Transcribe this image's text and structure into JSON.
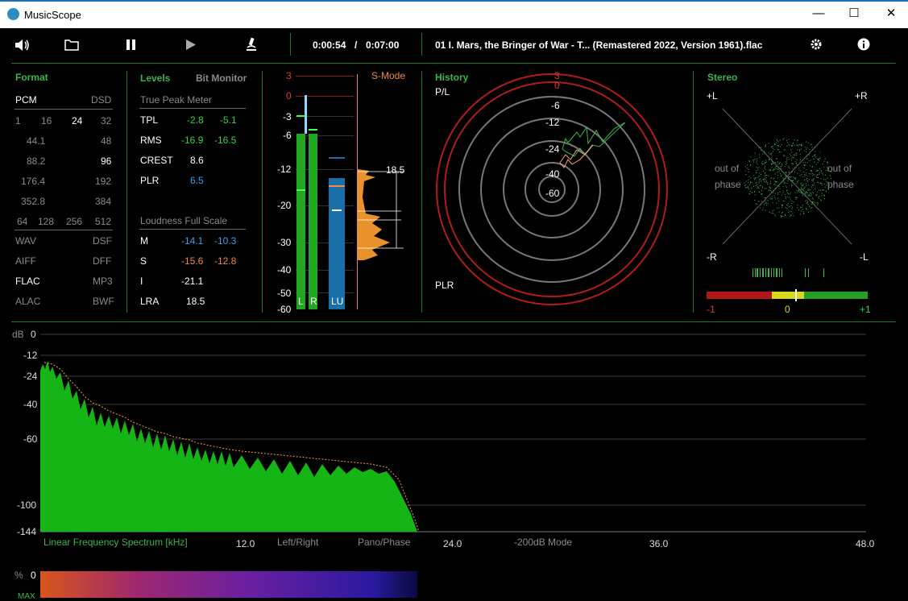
{
  "window": {
    "title": "MusicScope",
    "min": "—",
    "max": "☐",
    "close": "✕"
  },
  "toolbar": {
    "time_elapsed": "0:00:54",
    "time_sep": "/",
    "time_total": "0:07:00",
    "track": "01 I. Mars, the Bringer of War - T... (Remastered 2022, Version 1961).flac"
  },
  "format": {
    "title": "Format",
    "pcm": "PCM",
    "dsd": "DSD",
    "bits": [
      "1",
      "16",
      "24",
      "32"
    ],
    "rates": [
      [
        "44.1",
        "48"
      ],
      [
        "88.2",
        "96"
      ],
      [
        "176.4",
        "192"
      ],
      [
        "352.8",
        "384"
      ]
    ],
    "dsdrates": [
      "64",
      "128",
      "256",
      "512"
    ],
    "types": [
      [
        "WAV",
        "DSF"
      ],
      [
        "AIFF",
        "DFF"
      ],
      [
        "FLAC",
        "MP3"
      ],
      [
        "ALAC",
        "BWF"
      ]
    ]
  },
  "levels": {
    "title": "Levels",
    "bitmon": "Bit Monitor",
    "tpm_title": "True Peak Meter",
    "tpl": [
      "TPL",
      "-2.8",
      "-5.1"
    ],
    "rms": [
      "RMS",
      "-16.9",
      "-16.5"
    ],
    "crest": [
      "CREST",
      "8.6"
    ],
    "plr": [
      "PLR",
      "6.5"
    ],
    "lfs_title": "Loudness Full Scale",
    "m": [
      "M",
      "-14.1",
      "-10.3"
    ],
    "s": [
      "S",
      "-15.6",
      "-12.8"
    ],
    "i": [
      "I",
      "-21.1"
    ],
    "lra": [
      "LRA",
      "18.5"
    ]
  },
  "meter": {
    "scale": [
      "3",
      "0",
      "-3",
      "-6",
      "-12",
      "-20",
      "-30",
      "-40",
      "-50",
      "-60"
    ],
    "l": "L",
    "r": "R",
    "lu": "LU",
    "smode": "S-Mode",
    "lra_value": "18.5"
  },
  "history": {
    "title": "History",
    "pl": "P/L",
    "plr": "PLR",
    "rings": [
      "3",
      "0",
      "-6",
      "-12",
      "-24",
      "-40",
      "-60"
    ]
  },
  "stereo": {
    "title": "Stereo",
    "pl": "+L",
    "pr": "+R",
    "ml": "-R",
    "mr": "-L",
    "oop1": "out of",
    "oop2": "phase",
    "c1": "-1",
    "c0": "0",
    "c2": "+1",
    "correlation": 0.1
  },
  "spectrum": {
    "db": "dB",
    "yticks": [
      "0",
      "-12",
      "-24",
      "-40",
      "-60",
      "-100",
      "-144"
    ],
    "xticks": [
      "12.0",
      "24.0",
      "36.0",
      "48.0"
    ],
    "label": "Linear Frequency Spectrum [kHz]",
    "lr": "Left/Right",
    "pano": "Pano/Phase",
    "mode": "-200dB Mode"
  },
  "spectrogram": {
    "pct": "%",
    "zero": "0",
    "max": "MAX"
  },
  "colors": {
    "accent": "#3bb54a",
    "orange": "#f08a3c",
    "blue": "#3aa0e8",
    "ring": "#b01c1c"
  }
}
